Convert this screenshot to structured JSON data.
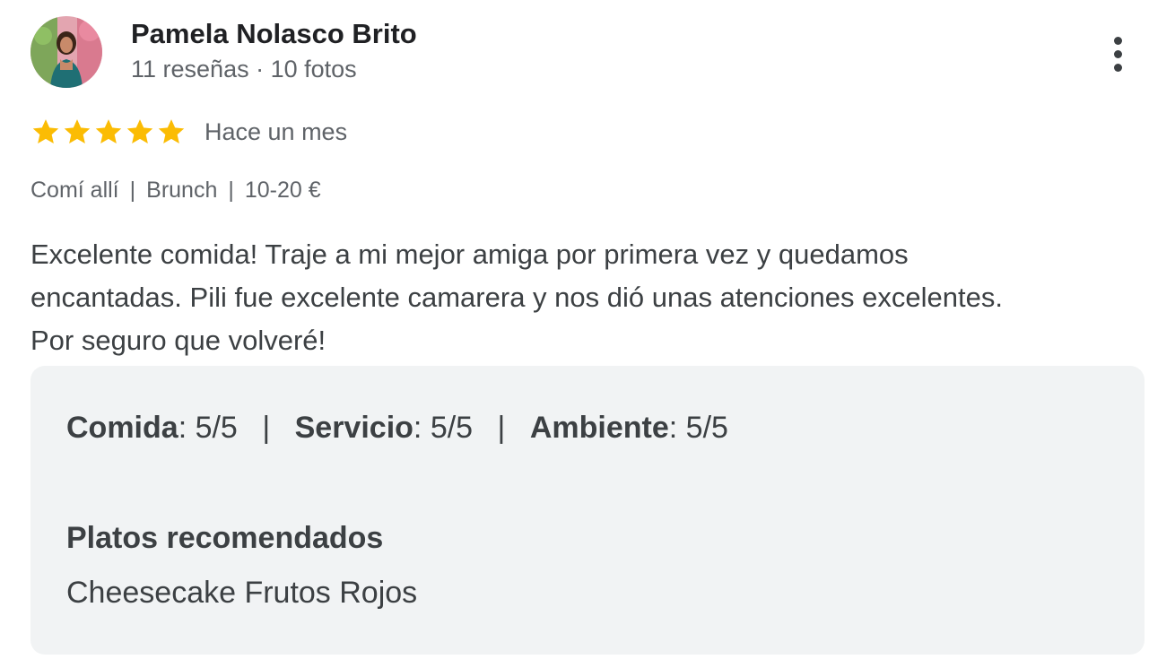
{
  "author": {
    "name": "Pamela Nolasco Brito",
    "meta": "11 reseñas · 10 fotos",
    "avatar_icon": "profile-photo"
  },
  "more_menu_icon": "vertical-dots-icon",
  "rating": {
    "stars": 5,
    "max_stars": 5,
    "star_color": "#fbbc04",
    "date": "Hace un mes"
  },
  "visit": {
    "tags": [
      "Comí allí",
      "Brunch",
      "10-20 €"
    ],
    "separator": "|"
  },
  "review": {
    "lines": [
      "Excelente comida! Traje a mi mejor amiga por primera vez y quedamos",
      "encantadas. Pili fue excelente camarera y nos dió unas atenciones excelentes.",
      "Por seguro que volveré!"
    ]
  },
  "details": {
    "ratings": [
      {
        "label": "Comida",
        "value": ": 5/5"
      },
      {
        "label": "Servicio",
        "value": ": 5/5"
      },
      {
        "label": "Ambiente",
        "value": ": 5/5"
      }
    ],
    "separator": "|",
    "dishes_heading": "Platos recomendados",
    "dishes_value": "Cheesecake Frutos Rojos"
  },
  "colors": {
    "panel_bg": "#f1f3f4",
    "secondary_text": "#5f6368",
    "star": "#fbbc04"
  }
}
